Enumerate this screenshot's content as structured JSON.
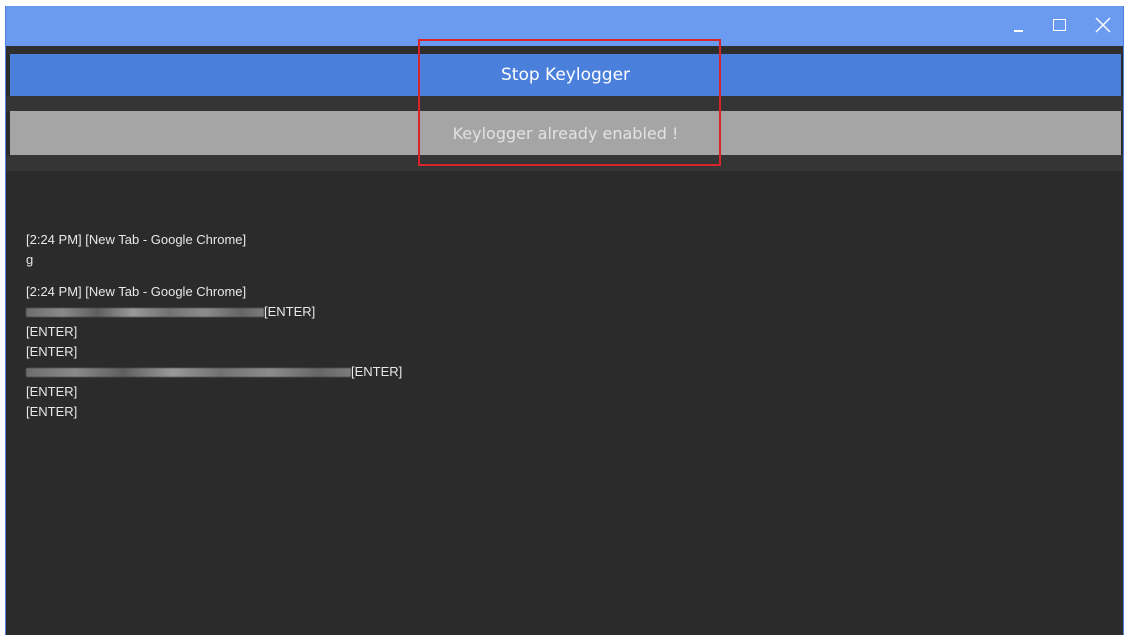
{
  "window": {
    "controls": {
      "minimize_icon": "minimize-icon",
      "maximize_icon": "maximize-icon",
      "close_icon": "close-icon"
    }
  },
  "toolbar": {
    "stop_label": "Stop Keylogger",
    "status_text": "Keylogger already enabled !"
  },
  "log": {
    "entries": [
      {
        "header": "[2:24 PM] [New Tab - Google Chrome]",
        "lines": [
          "g"
        ]
      },
      {
        "header": "[2:24 PM] [New Tab - Google Chrome]",
        "lines": [
          "[ENTER]",
          "[ENTER]",
          "[ENTER]",
          "[ENTER]",
          "[ENTER]",
          "[ENTER]"
        ]
      }
    ]
  },
  "colors": {
    "titlebar": "#6a9bf0",
    "accent_button": "#4a7fdc",
    "status_bar": "#a5a5a5",
    "background": "#2b2b2b",
    "highlight": "#d8242c"
  }
}
